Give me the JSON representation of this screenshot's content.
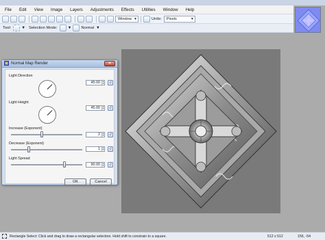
{
  "menu": [
    "File",
    "Edit",
    "View",
    "Image",
    "Layers",
    "Adjustments",
    "Effects",
    "Utilities",
    "Window",
    "Help"
  ],
  "toolbar": {
    "window_label": "Window",
    "units_label": "Units:",
    "units_value": "Pixels"
  },
  "tool_options": {
    "tool_label": "Tool:",
    "selection_mode_label": "Selection Mode:",
    "mode_value": "Normal"
  },
  "dialog": {
    "title": "Normal Map Render",
    "ok_label": "OK",
    "cancel_label": "Cancel",
    "params": {
      "light_direction": {
        "label": "Light Direction",
        "value": "45.00",
        "angle_deg": 45
      },
      "light_height": {
        "label": "Light Height",
        "value": "45.00",
        "angle_deg": 45
      },
      "increase": {
        "label": "Increase (Exponent)",
        "value": "2",
        "position": 0.43
      },
      "decrease": {
        "label": "Decrease (Exponent)",
        "value": "1",
        "position": 0.24
      },
      "light_spread": {
        "label": "Light Spread",
        "value": "90.00",
        "position": 0.76
      }
    }
  },
  "status": {
    "hint": "Rectangle Select: Click and drag to draw a rectangular selection. Hold shift to constrain to a square.",
    "image_size": "512 x 512",
    "cursor": "156, -54"
  },
  "icons": [
    "selection-icon",
    "reset-icon",
    "close-icon",
    "plugin-icon"
  ],
  "colors": {
    "canvas_bg": "#ababab",
    "dialog_bg": "#d4dfee",
    "thumbnail": "#7e8bf0"
  }
}
